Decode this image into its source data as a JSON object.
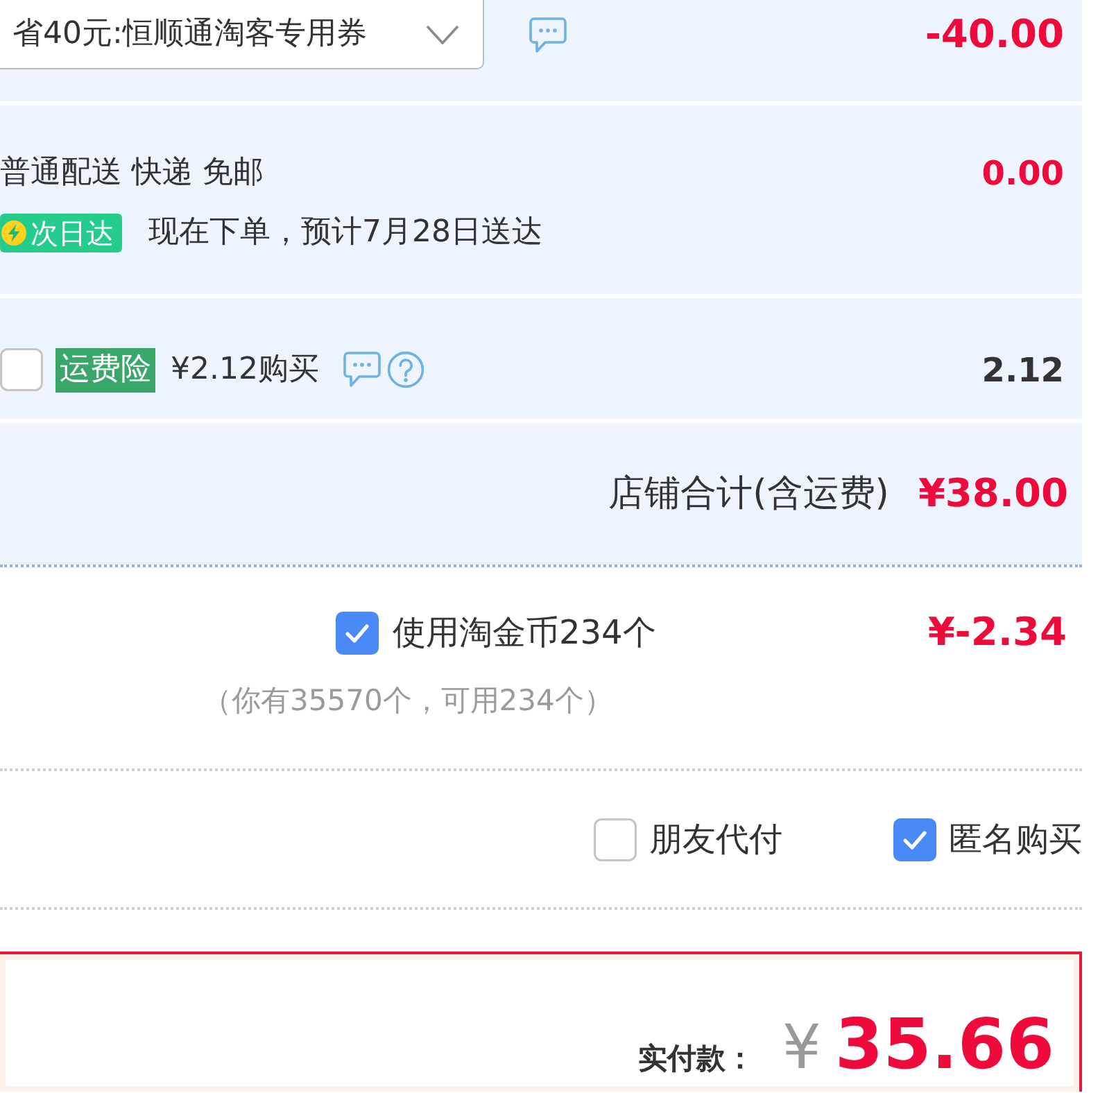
{
  "coupon": {
    "value": "省40元:恒顺通淘客专用券",
    "amount": "-40.00"
  },
  "delivery": {
    "method": "普通配送 快递 免邮",
    "badge": "次日达",
    "estimate": "现在下单，预计7月28日送达",
    "amount": "0.00"
  },
  "shipping_insurance": {
    "checked": false,
    "tag": "运费险",
    "price": "¥2.12购买",
    "amount": "2.12"
  },
  "store_total": {
    "label": "店铺合计(含运费)",
    "amount": "¥38.00"
  },
  "coins": {
    "checked": true,
    "label": "使用淘金币234个",
    "amount": "¥-2.34",
    "note": "（你有35570个，可用234个）"
  },
  "options": [
    {
      "label": "朋友代付",
      "checked": false
    },
    {
      "label": "匿名购买",
      "checked": true
    }
  ],
  "payment": {
    "label": "实付款：",
    "currency": "¥",
    "amount": "35.66"
  }
}
